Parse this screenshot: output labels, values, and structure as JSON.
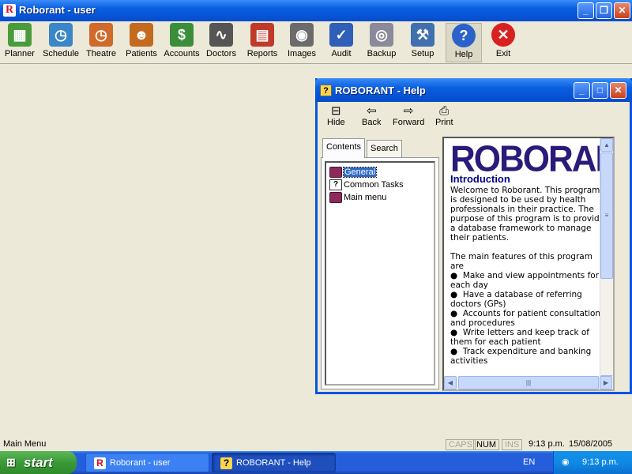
{
  "app": {
    "title": "Roborant - user",
    "logo_letter": "R"
  },
  "window_controls": {
    "minimize": "_",
    "maximize": "❐",
    "close": "✕"
  },
  "toolbar": {
    "items": [
      {
        "label": "Planner",
        "icon": "calendar-icon",
        "glyph": "▦",
        "color": "#4a9b3c"
      },
      {
        "label": "Schedule",
        "icon": "clock-calendar-icon",
        "glyph": "◷",
        "color": "#3b86c8"
      },
      {
        "label": "Theatre",
        "icon": "theatre-calendar-icon",
        "glyph": "◷",
        "color": "#d06a2b"
      },
      {
        "label": "Patients",
        "icon": "people-icon",
        "glyph": "☻",
        "color": "#c46a1e"
      },
      {
        "label": "Accounts",
        "icon": "dollar-icon",
        "glyph": "$",
        "color": "#3a8e3a"
      },
      {
        "label": "Doctors",
        "icon": "stethoscope-icon",
        "glyph": "∿",
        "color": "#555555"
      },
      {
        "label": "Reports",
        "icon": "report-icon",
        "glyph": "▤",
        "color": "#c03a2a"
      },
      {
        "label": "Images",
        "icon": "camera-icon",
        "glyph": "◉",
        "color": "#6b6b6b"
      },
      {
        "label": "Audit",
        "icon": "audit-icon",
        "glyph": "✓",
        "color": "#2f5fb8"
      },
      {
        "label": "Backup",
        "icon": "disc-icon",
        "glyph": "◎",
        "color": "#8a8a9a"
      },
      {
        "label": "Setup",
        "icon": "tools-icon",
        "glyph": "⚒",
        "color": "#4070b0"
      },
      {
        "label": "Help",
        "icon": "help-icon",
        "glyph": "?",
        "color": "#2a62c9"
      },
      {
        "label": "Exit",
        "icon": "exit-icon",
        "glyph": "✕",
        "color": "#d92020"
      }
    ]
  },
  "help_window": {
    "title": "ROBORANT - Help",
    "tools": [
      {
        "label": "Hide",
        "glyph": "⊟"
      },
      {
        "label": "Back",
        "glyph": "⇦"
      },
      {
        "label": "Forward",
        "glyph": "⇨"
      },
      {
        "label": "Print",
        "glyph": "⎙"
      }
    ],
    "tabs": [
      "Contents",
      "Search"
    ],
    "tree": [
      {
        "label": "General",
        "icon": "book",
        "selected": true
      },
      {
        "label": "Common Tasks",
        "icon": "question-doc"
      },
      {
        "label": "Main menu",
        "icon": "book"
      }
    ],
    "content": {
      "logo": "ROBORANT",
      "heading": "Introduction",
      "paragraph1": "Welcome to Roborant. This program is designed to be used by health professionals in their practice. The purpose of this program is to provide a database framework to manage their patients.",
      "paragraph2": "The main features of this program are",
      "bullets": [
        "Make and view appointments for each day",
        "Have a database of referring doctors (GPs)",
        "Accounts for patient consultations and procedures",
        "Write letters and keep track of them for each patient",
        "Track expenditure and banking activities"
      ]
    }
  },
  "statusbar": {
    "message": "Main Menu",
    "caps": "CAPS",
    "num": "NUM",
    "ins": "INS",
    "time": "9:13 p.m.",
    "date": "15/08/2005"
  },
  "taskbar": {
    "start": "start",
    "tasks": [
      {
        "label": "Roborant - user",
        "icon": "R"
      },
      {
        "label": "ROBORANT - Help",
        "icon": "?"
      }
    ],
    "language": "EN",
    "clock": "9:13 p.m."
  }
}
